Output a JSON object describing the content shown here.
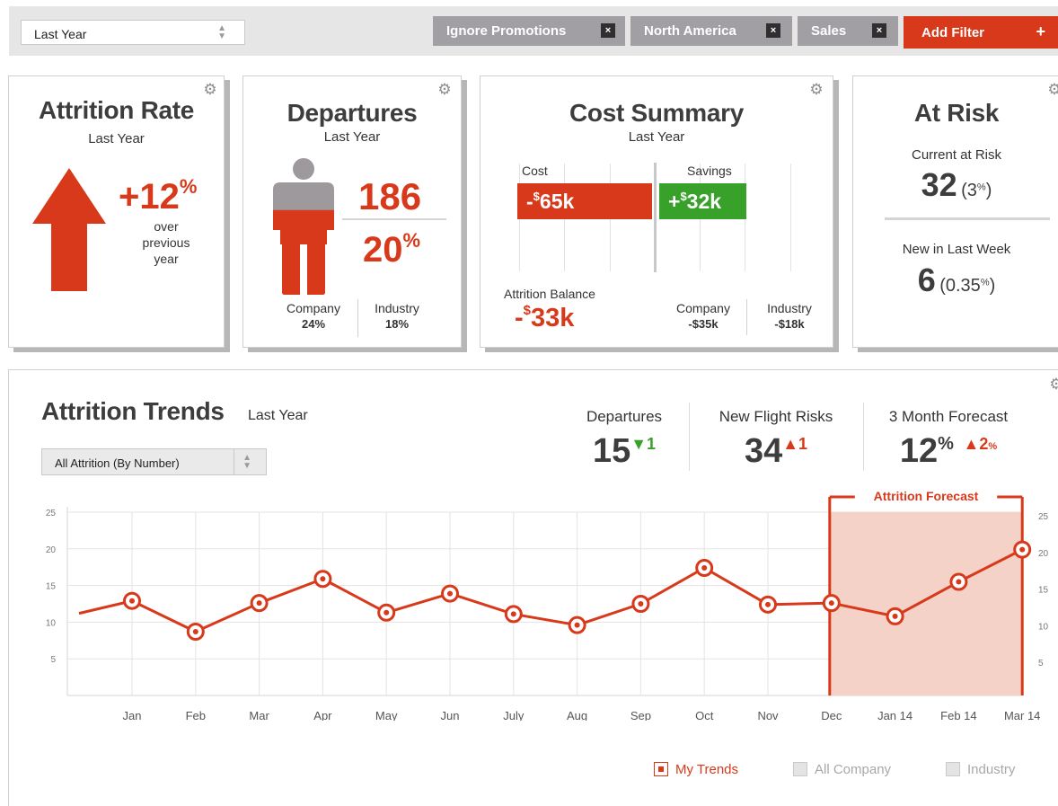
{
  "filters": {
    "period_value": "Last Year",
    "chips": [
      {
        "label": "Ignore Promotions"
      },
      {
        "label": "North America"
      },
      {
        "label": "Sales"
      }
    ],
    "close_symbol": "×",
    "add_label": "Add Filter",
    "add_symbol": "+"
  },
  "attrition_rate": {
    "title": "Attrition Rate",
    "period": "Last Year",
    "value": "+12",
    "unit": "%",
    "desc_line1": "over",
    "desc_line2": "previous",
    "desc_line3": "year"
  },
  "departures": {
    "title": "Departures",
    "period": "Last Year",
    "count": "186",
    "pct": "20",
    "unit": "%",
    "fill_fraction": 0.2,
    "company_label": "Company",
    "company_value": "24%",
    "industry_label": "Industry",
    "industry_value": "18%"
  },
  "cost_summary": {
    "title": "Cost Summary",
    "period": "Last Year",
    "cost_label": "Cost",
    "savings_label": "Savings",
    "cost_prefix": "-",
    "cost_currency": "$",
    "cost_amount": "65k",
    "savings_prefix": "+",
    "savings_currency": "$",
    "savings_amount": "32k",
    "balance_label": "Attrition Balance",
    "balance_prefix": "-",
    "balance_currency": "$",
    "balance_amount": "33k",
    "company_label": "Company",
    "company_value": "-$35k",
    "industry_label": "Industry",
    "industry_value": "-$18k"
  },
  "at_risk": {
    "title": "At Risk",
    "current_label": "Current at Risk",
    "current_value": "32",
    "current_pct_open": "(3",
    "current_pct_unit": "%",
    "current_pct_close": ")",
    "new_label": "New in Last Week",
    "new_value": "6",
    "new_pct_open": "(0.35",
    "new_pct_unit": "%",
    "new_pct_close": ")"
  },
  "trends": {
    "title": "Attrition Trends",
    "period": "Last Year",
    "select_value": "All Attrition (By Number)",
    "kpis": {
      "departures_label": "Departures",
      "departures_value": "15",
      "departures_delta": "1",
      "flight_label": "New Flight Risks",
      "flight_value": "34",
      "flight_delta": "1",
      "forecast_label": "3 Month Forecast",
      "forecast_value": "12",
      "forecast_unit": "%",
      "forecast_delta": "2",
      "forecast_delta_unit": "%"
    },
    "legend": {
      "my_trends": "My Trends",
      "all_company": "All Company",
      "industry": "Industry"
    },
    "forecast_label": "Attrition Forecast"
  },
  "chart_data": {
    "type": "line",
    "categories": [
      "Jan",
      "Feb",
      "Mar",
      "Apr",
      "May",
      "Jun",
      "July",
      "Aug",
      "Sep",
      "Oct",
      "Nov",
      "Dec",
      "Jan 14",
      "Feb 14",
      "Mar 14"
    ],
    "series": [
      {
        "name": "My Trends",
        "start_value": 11.2,
        "values": [
          12.9,
          8.7,
          12.6,
          15.9,
          11.3,
          13.9,
          11.1,
          9.6,
          12.5,
          17.4,
          12.4,
          12.6,
          10.8,
          15.5,
          19.9
        ]
      }
    ],
    "forecast_range": [
      "Dec",
      "Mar 14"
    ],
    "y_ticks": [
      5,
      10,
      15,
      20,
      25
    ],
    "ylim": [
      0,
      25
    ],
    "grid": true,
    "colors": {
      "line": "#d8391a",
      "forecast_fill": "#f5d2c7"
    }
  },
  "colors": {
    "accent": "#d8391a",
    "positive": "#37a12a",
    "chip": "#a29fa4"
  }
}
